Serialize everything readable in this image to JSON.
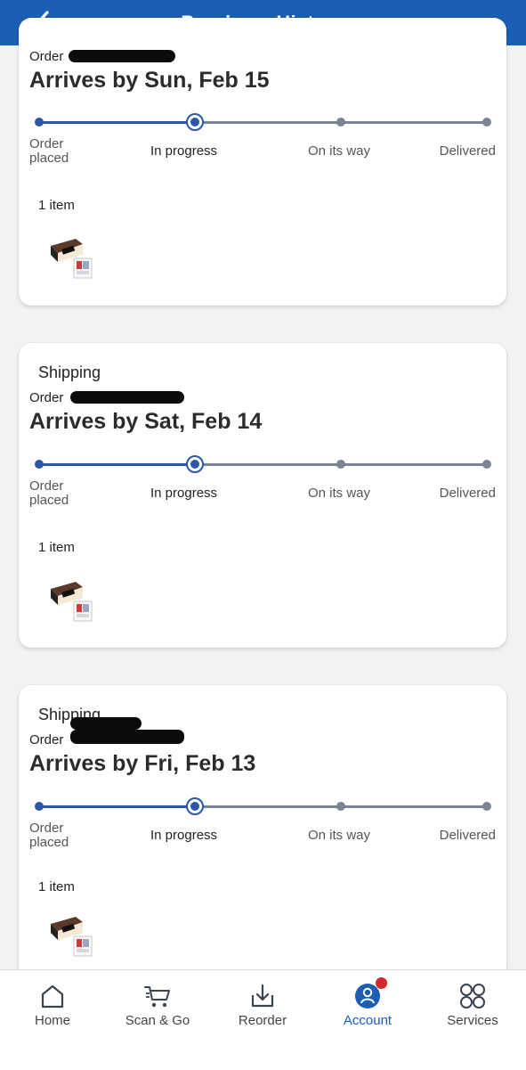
{
  "header": {
    "title": "Purchase History"
  },
  "orders": [
    {
      "status_label": "",
      "order_prefix": "Order",
      "arrives": "Arrives by Sun, Feb 15",
      "progress_step": 1,
      "steps": [
        "Order placed",
        "In progress",
        "On its way",
        "Delivered"
      ],
      "items_count": "1 item",
      "thumb_icon": "product-thumbnail"
    },
    {
      "status_label": "Shipping",
      "order_prefix": "Order",
      "arrives": "Arrives by Sat, Feb 14",
      "progress_step": 1,
      "steps": [
        "Order placed",
        "In progress",
        "On its way",
        "Delivered"
      ],
      "items_count": "1 item",
      "thumb_icon": "product-thumbnail"
    },
    {
      "status_label": "Shipping",
      "order_prefix": "Order",
      "arrives": "Arrives by Fri, Feb 13",
      "progress_step": 1,
      "steps": [
        "Order placed",
        "In progress",
        "On its way",
        "Delivered"
      ],
      "items_count": "1 item",
      "thumb_icon": "product-thumbnail"
    }
  ],
  "tabbar": {
    "items": [
      {
        "label": "Home",
        "icon": "home-icon"
      },
      {
        "label": "Scan & Go",
        "icon": "scan-cart-icon"
      },
      {
        "label": "Reorder",
        "icon": "reorder-icon"
      },
      {
        "label": "Account",
        "icon": "account-icon",
        "active": true,
        "notification": true
      },
      {
        "label": "Services",
        "icon": "services-grid-icon"
      }
    ]
  },
  "colors": {
    "brand": "#1a5fb4",
    "progress_done": "#2c57a8",
    "progress_pending": "#7a8593",
    "notification": "#d22a2a"
  }
}
